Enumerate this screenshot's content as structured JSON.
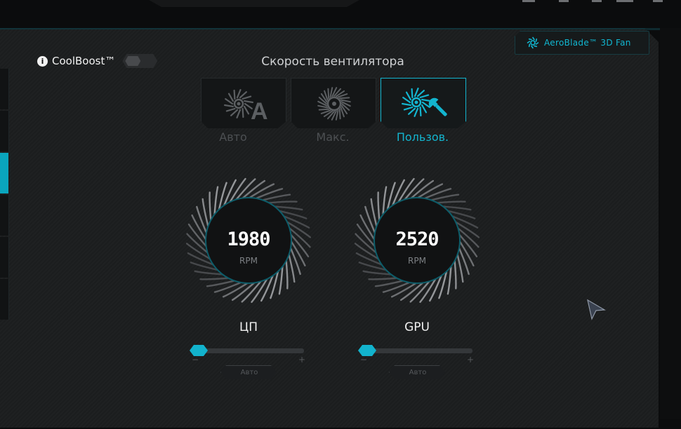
{
  "header": {
    "badge_label": "AeroBlade™ 3D Fan",
    "accent_color": "#13b5cf"
  },
  "coolboost": {
    "label": "CoolBoost™",
    "info_icon": "info-icon",
    "enabled": false
  },
  "fan_speed": {
    "title": "Скорость вентилятора",
    "modes": [
      {
        "label": "Авто",
        "icon": "fan-auto-icon",
        "active": false
      },
      {
        "label": "Макс.",
        "icon": "fan-max-icon",
        "active": false
      },
      {
        "label": "Пользов.",
        "icon": "fan-custom-icon",
        "active": true
      }
    ]
  },
  "fans": [
    {
      "name": "ЦП",
      "rpm": "1980",
      "unit": "RPM",
      "slider_value": 0,
      "minus": "−",
      "plus": "+",
      "auto_label": "Авто"
    },
    {
      "name": "GPU",
      "rpm": "2520",
      "unit": "RPM",
      "slider_value": 0,
      "minus": "−",
      "plus": "+",
      "auto_label": "Авто"
    }
  ]
}
